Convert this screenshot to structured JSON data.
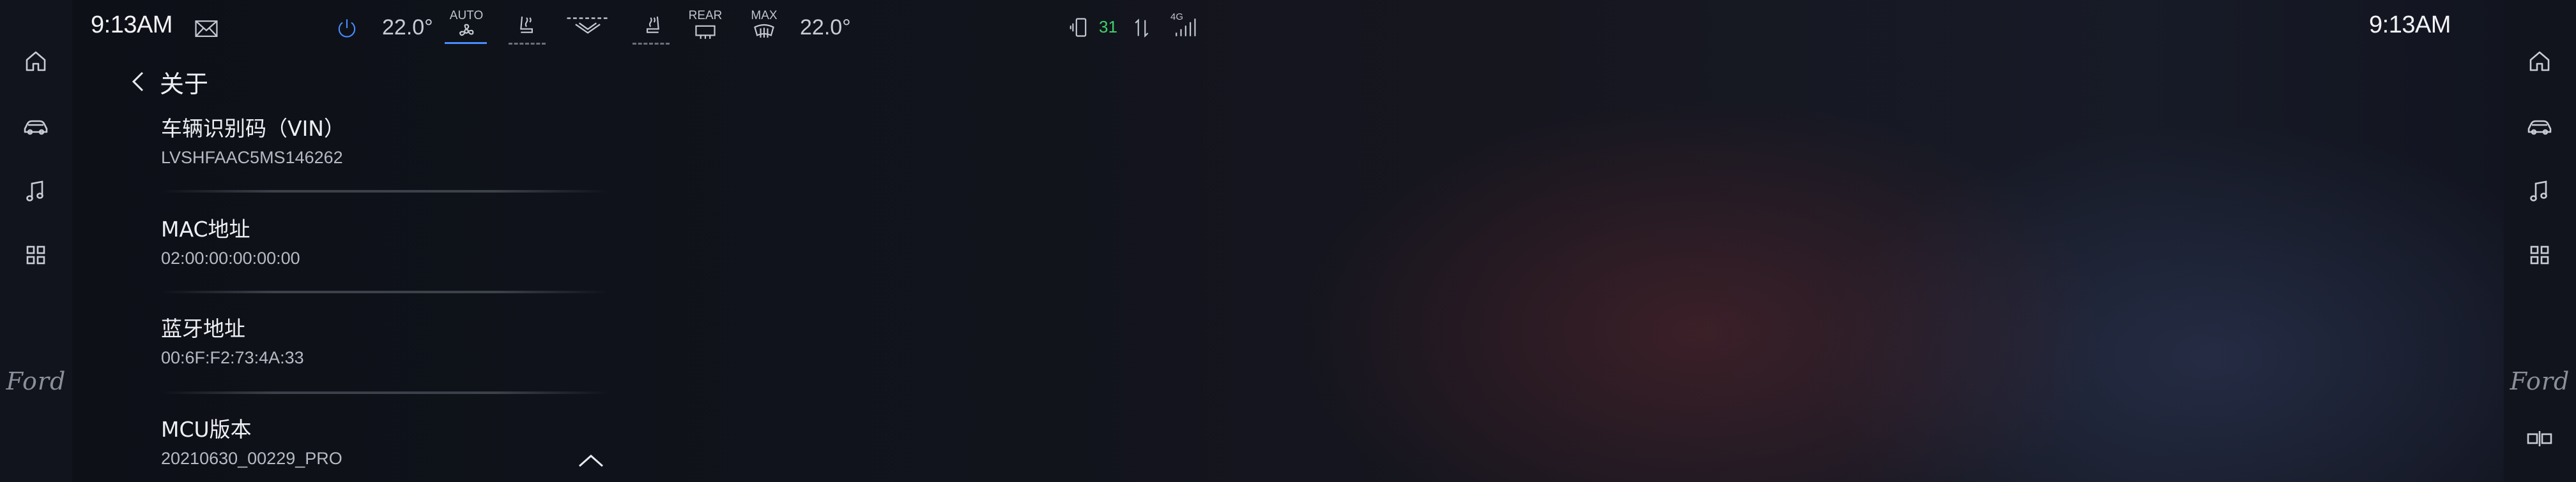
{
  "status_bar": {
    "left_clock": "9:13AM",
    "right_clock": "9:13AM",
    "driver_temp": "22.0°",
    "passenger_temp": "22.0°",
    "auto_label": "AUTO",
    "rear_label": "REAR",
    "max_label": "MAX",
    "signal_value": "31",
    "network_label": "4G",
    "accent_color": "#4a8cff",
    "signal_color": "#3fd26a"
  },
  "left_rail": {
    "items": [
      "home-icon",
      "car-icon",
      "music-icon",
      "apps-icon"
    ],
    "brand": "Ford"
  },
  "right_rail": {
    "items": [
      "home-icon",
      "car-icon",
      "music-icon",
      "apps-icon"
    ],
    "brand": "Ford"
  },
  "page": {
    "title": "关于",
    "rows": [
      {
        "label": "车辆识别码（VIN）",
        "value": "LVSHFAAC5MS146262"
      },
      {
        "label": "MAC地址",
        "value": "02:00:00:00:00:00"
      },
      {
        "label": "蓝牙地址",
        "value": "00:6F:F2:73:4A:33"
      },
      {
        "label": "MCU版本",
        "value": "20210630_00229_PRO"
      }
    ]
  }
}
